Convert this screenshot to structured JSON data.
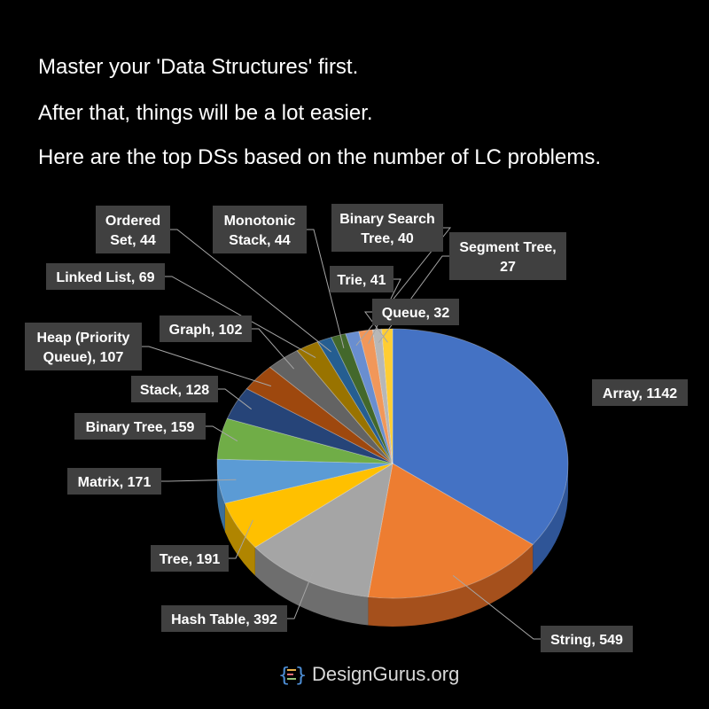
{
  "header": {
    "line1": "Master your 'Data Structures' first.",
    "line2": "After that, things will be a lot easier.",
    "line3": "Here are the top DSs based on the number of LC problems."
  },
  "brand": {
    "logo_icon": "code-braces-icon",
    "name": "DesignGurus.org"
  },
  "chart_data": {
    "type": "pie",
    "style": "3d-tilted",
    "label_style": "dark-gray boxes with leader lines",
    "slices": [
      {
        "label": "Array, 1142",
        "name": "Array",
        "value": 1142,
        "color": "#4472c4",
        "side": "#2f5597"
      },
      {
        "label": "String, 549",
        "name": "String",
        "value": 549,
        "color": "#ed7d31",
        "side": "#a5501c"
      },
      {
        "label": "Hash Table, 392",
        "name": "Hash Table",
        "value": 392,
        "color": "#a5a5a5",
        "side": "#6e6e6e"
      },
      {
        "label": "Tree, 191",
        "name": "Tree",
        "value": 191,
        "color": "#ffc000",
        "side": "#b08500"
      },
      {
        "label": "Matrix, 171",
        "name": "Matrix",
        "value": 171,
        "color": "#5b9bd5",
        "side": "#3a6e9c"
      },
      {
        "label": "Binary Tree, 159",
        "name": "Binary Tree",
        "value": 159,
        "color": "#70ad47",
        "side": "#4b7a2e"
      },
      {
        "label": "Stack, 128",
        "name": "Stack",
        "value": 128,
        "color": "#264478",
        "side": "#18305a"
      },
      {
        "label": "Heap (Priority Queue), 107",
        "name": "Heap (Priority Queue)",
        "value": 107,
        "color": "#9e480e",
        "side": "#6d300a"
      },
      {
        "label": "Graph, 102",
        "name": "Graph",
        "value": 102,
        "color": "#636363",
        "side": "#404040"
      },
      {
        "label": "Linked List, 69",
        "name": "Linked List",
        "value": 69,
        "color": "#997300",
        "side": "#6b5000"
      },
      {
        "label": "Ordered Set, 44",
        "name": "Ordered Set",
        "value": 44,
        "color": "#255e91",
        "side": "#183f63"
      },
      {
        "label": "Monotonic Stack, 44",
        "name": "Monotonic Stack",
        "value": 44,
        "color": "#43682b",
        "side": "#2d4720"
      },
      {
        "label": "Binary Search Tree, 40",
        "name": "Binary Search Tree",
        "value": 40,
        "color": "#698ed0",
        "side": "#4a6aa3"
      },
      {
        "label": "Trie, 41",
        "name": "Trie",
        "value": 41,
        "color": "#f1975a",
        "side": "#b3693a"
      },
      {
        "label": "Segment Tree, 27",
        "name": "Segment Tree",
        "value": 27,
        "color": "#b7b7b7",
        "side": "#808080"
      },
      {
        "label": "Queue, 32",
        "name": "Queue",
        "value": 32,
        "color": "#ffcd33",
        "side": "#b38f1f"
      }
    ]
  }
}
